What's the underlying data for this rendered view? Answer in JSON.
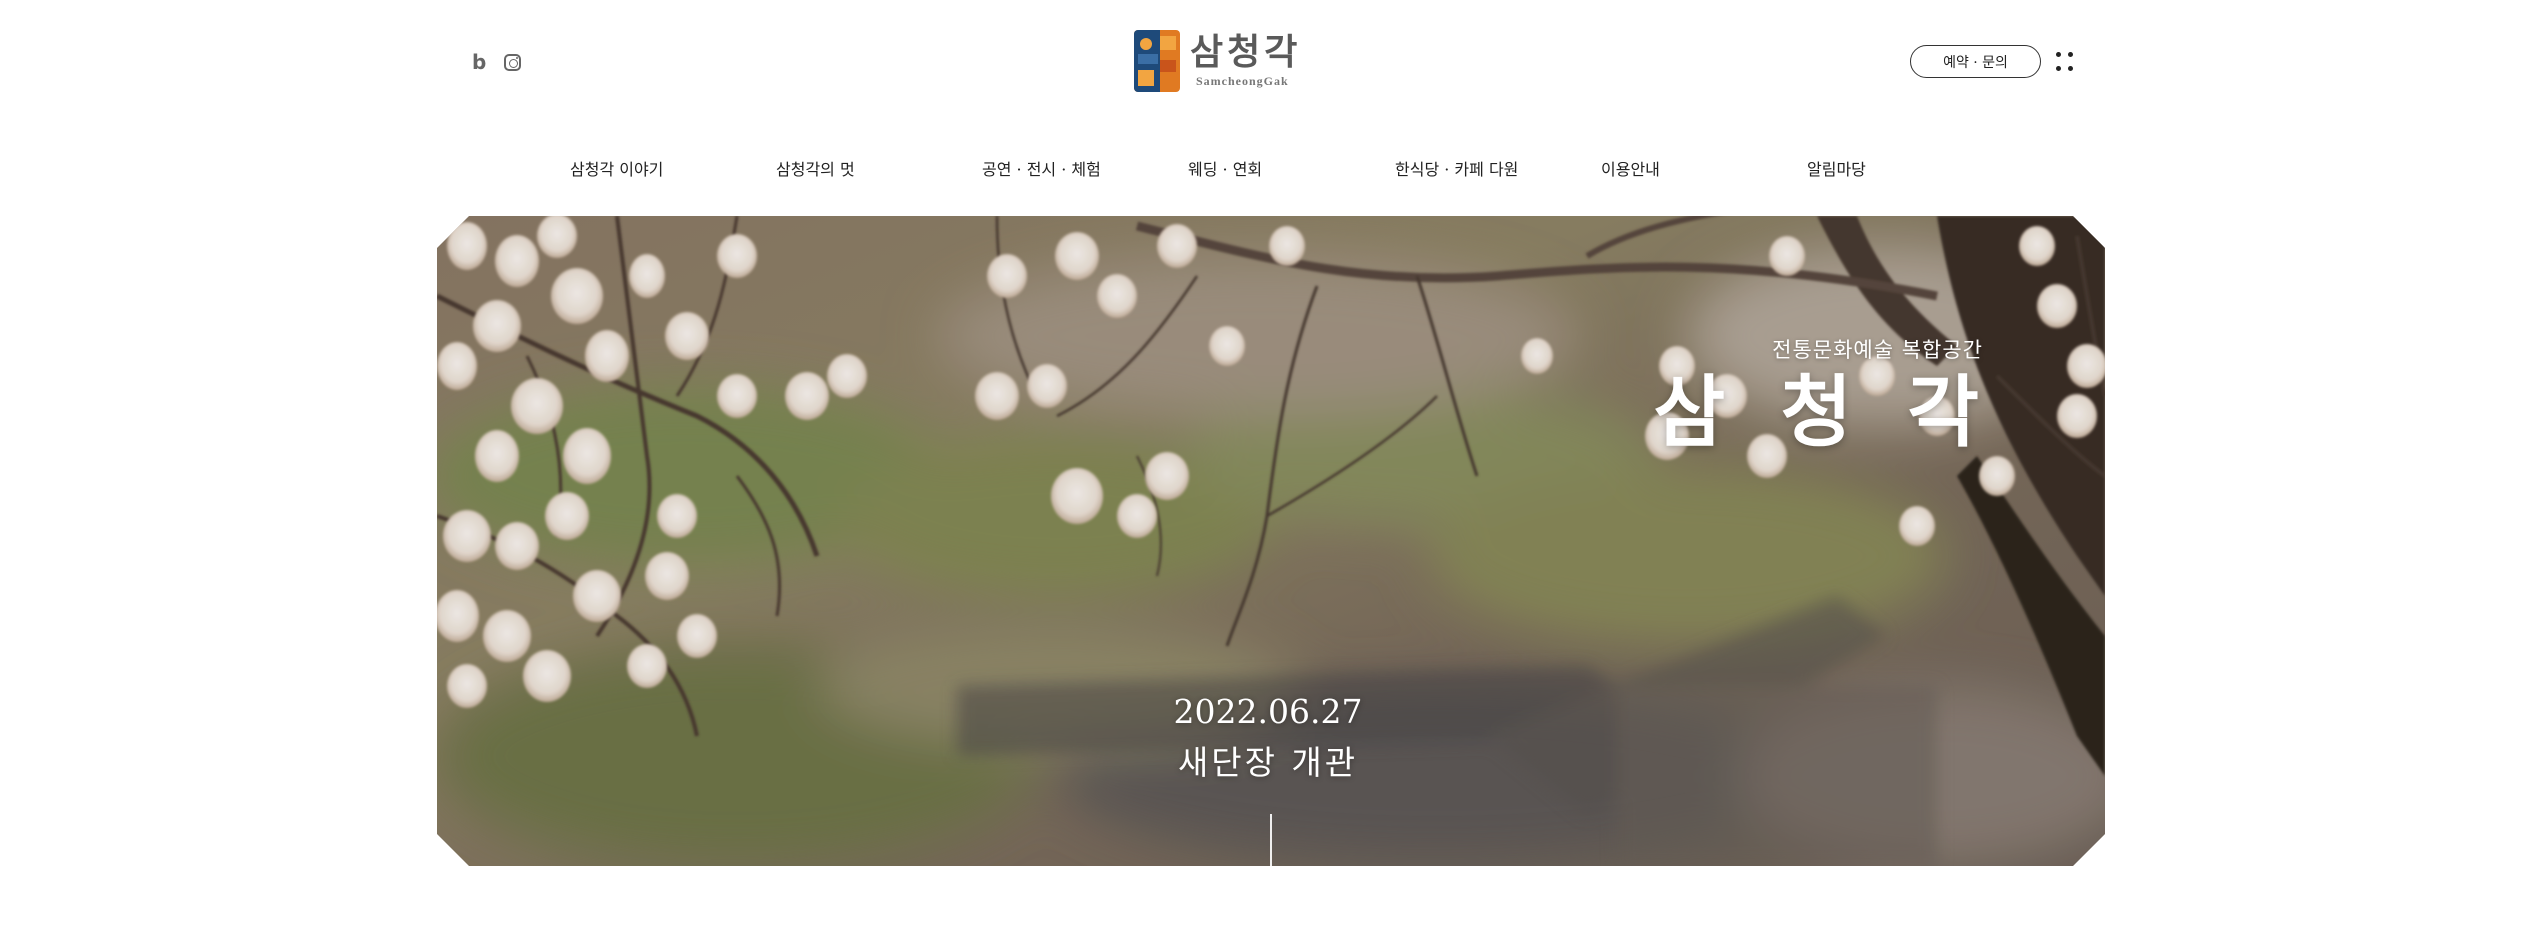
{
  "header": {
    "social": [
      {
        "name": "blog",
        "label": "b"
      },
      {
        "name": "instagram",
        "icon": "instagram-icon"
      }
    ],
    "logo": {
      "korean": "삼청각",
      "english": "SamcheongGak",
      "colors": [
        "#1e4a7a",
        "#e07a22",
        "#f2a541",
        "#3a6ea5"
      ]
    },
    "reserve_button": "예약 · 문의",
    "menu_icon": "grid-dots-icon"
  },
  "nav": {
    "items": [
      {
        "label": "삼청각 이야기"
      },
      {
        "label": "삼청각의 멋"
      },
      {
        "label": "공연 · 전시 · 체험"
      },
      {
        "label": "웨딩 · 연회"
      },
      {
        "label": "한식당 · 카페 다원"
      },
      {
        "label": "이용안내"
      },
      {
        "label": "알림마당"
      }
    ]
  },
  "hero": {
    "subtitle": "전통문화예술 복합공간",
    "title": "삼 청 각",
    "date": "2022.06.27",
    "caption": "새단장 개관"
  }
}
